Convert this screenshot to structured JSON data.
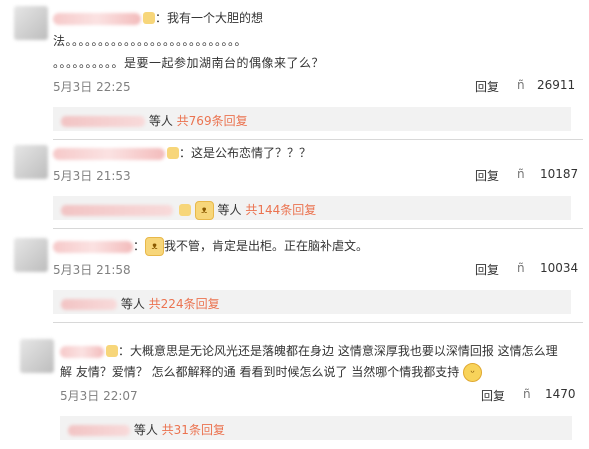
{
  "comments": [
    {
      "line1": "：我有一个大胆的想",
      "line2": "法。。。。。。。。。。。。。。。。。。。。。。。。。。。",
      "line3": "。。。。。。。。。。是要一起参加湖南台的偶像来了么？",
      "date": "5月3日 22:25",
      "reply": "回复",
      "likes": "26911",
      "sub_text": "等人",
      "sub_link": "共769条回复"
    },
    {
      "line1": "：这是公布恋情了？？？",
      "date": "5月3日 21:53",
      "reply": "回复",
      "likes": "10187",
      "sub_text": "等人",
      "sub_link": "共144条回复"
    },
    {
      "line1_pre": "：",
      "line1": "我不管，肯定是出柜。正在脑补虐文。",
      "date": "5月3日 21:58",
      "reply": "回复",
      "likes": "10034",
      "sub_text": "等人",
      "sub_link": "共224条回复"
    },
    {
      "line1": "：大概意思是无论风光还是落魄都在身边 这情意深厚我也要以深情回报 这情怎么理",
      "line2": "解 友情？爱情？ 怎么都解释的通 看看到时候怎么说了 当然哪个情我都支持",
      "date": "5月3日 22:07",
      "reply": "回复",
      "likes": "1470",
      "sub_text": "等人",
      "sub_link": "共31条回复"
    }
  ],
  "icons": {
    "like": "like-thumb-icon",
    "badge": "member-badge-icon",
    "emoji_cat": "cat-emoji-icon",
    "emoji_grin": "grin-emoji-icon"
  },
  "colors": {
    "link": "#eb7350",
    "meta": "#808080",
    "subbox": "#f2f2f2"
  }
}
